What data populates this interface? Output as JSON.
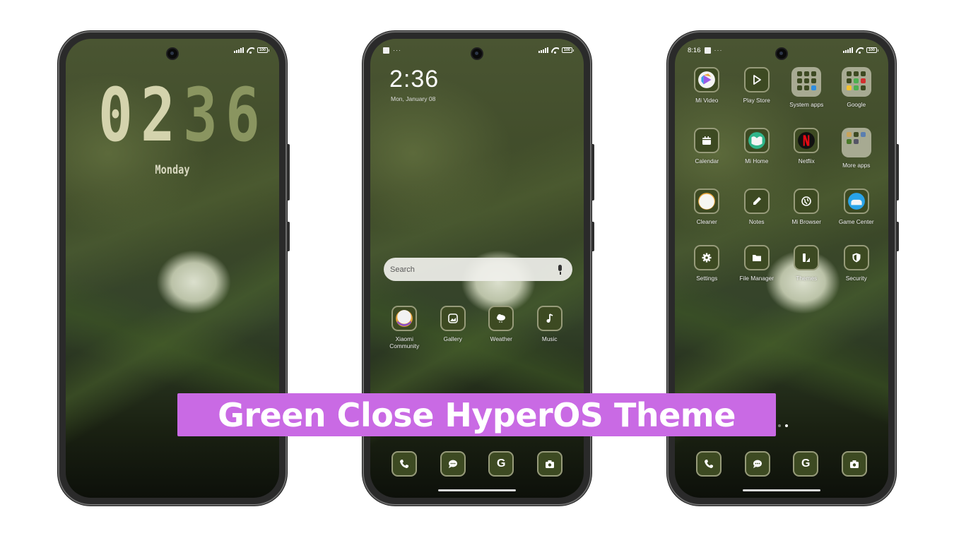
{
  "banner": {
    "title": "Green Close HyperOS Theme",
    "background_color": "#c96ae4"
  },
  "theme": {
    "icon_bg": "#3d4a22",
    "clock_light": "#d4d3ad",
    "clock_dark": "#8a9560"
  },
  "phones": {
    "lock": {
      "status": {
        "battery": "100"
      },
      "clock_digits": [
        "0",
        "2",
        "3",
        "6"
      ],
      "day": "Monday"
    },
    "home1": {
      "status": {
        "notif_dots": "···",
        "battery": "100"
      },
      "time": "2:36",
      "date": "Mon, January 08",
      "search": {
        "placeholder": "Search"
      },
      "apps": [
        {
          "label": "Xiaomi Community",
          "icon": "xiaomi-community-icon"
        },
        {
          "label": "Gallery",
          "icon": "gallery-icon"
        },
        {
          "label": "Weather",
          "icon": "weather-icon"
        },
        {
          "label": "Music",
          "icon": "music-icon"
        }
      ],
      "dock": [
        {
          "icon": "phone-icon"
        },
        {
          "icon": "messages-icon"
        },
        {
          "icon": "google-icon"
        },
        {
          "icon": "camera-icon"
        }
      ]
    },
    "home2": {
      "status": {
        "time": "8:16",
        "notif_dots": "···",
        "battery": "100"
      },
      "apps": [
        {
          "label": "Mi Video",
          "icon": "mi-video-icon"
        },
        {
          "label": "Play Store",
          "icon": "play-store-icon"
        },
        {
          "label": "System apps",
          "icon": "folder-icon"
        },
        {
          "label": "Google",
          "icon": "folder-icon"
        },
        {
          "label": "Calendar",
          "icon": "calendar-icon"
        },
        {
          "label": "Mi Home",
          "icon": "mi-home-icon"
        },
        {
          "label": "Netflix",
          "icon": "netflix-icon"
        },
        {
          "label": "More apps",
          "icon": "folder-icon"
        },
        {
          "label": "Cleaner",
          "icon": "cleaner-icon"
        },
        {
          "label": "Notes",
          "icon": "notes-icon"
        },
        {
          "label": "Mi Browser",
          "icon": "browser-icon"
        },
        {
          "label": "Game Center",
          "icon": "game-center-icon"
        },
        {
          "label": "Settings",
          "icon": "settings-icon"
        },
        {
          "label": "File Manager",
          "icon": "file-manager-icon"
        },
        {
          "label": "Themes",
          "icon": "themes-icon"
        },
        {
          "label": "Security",
          "icon": "security-icon"
        }
      ],
      "page_indicator": {
        "pages": 2,
        "current": 2
      },
      "dock": [
        {
          "icon": "phone-icon"
        },
        {
          "icon": "messages-icon"
        },
        {
          "icon": "google-icon"
        },
        {
          "icon": "camera-icon"
        }
      ]
    }
  }
}
